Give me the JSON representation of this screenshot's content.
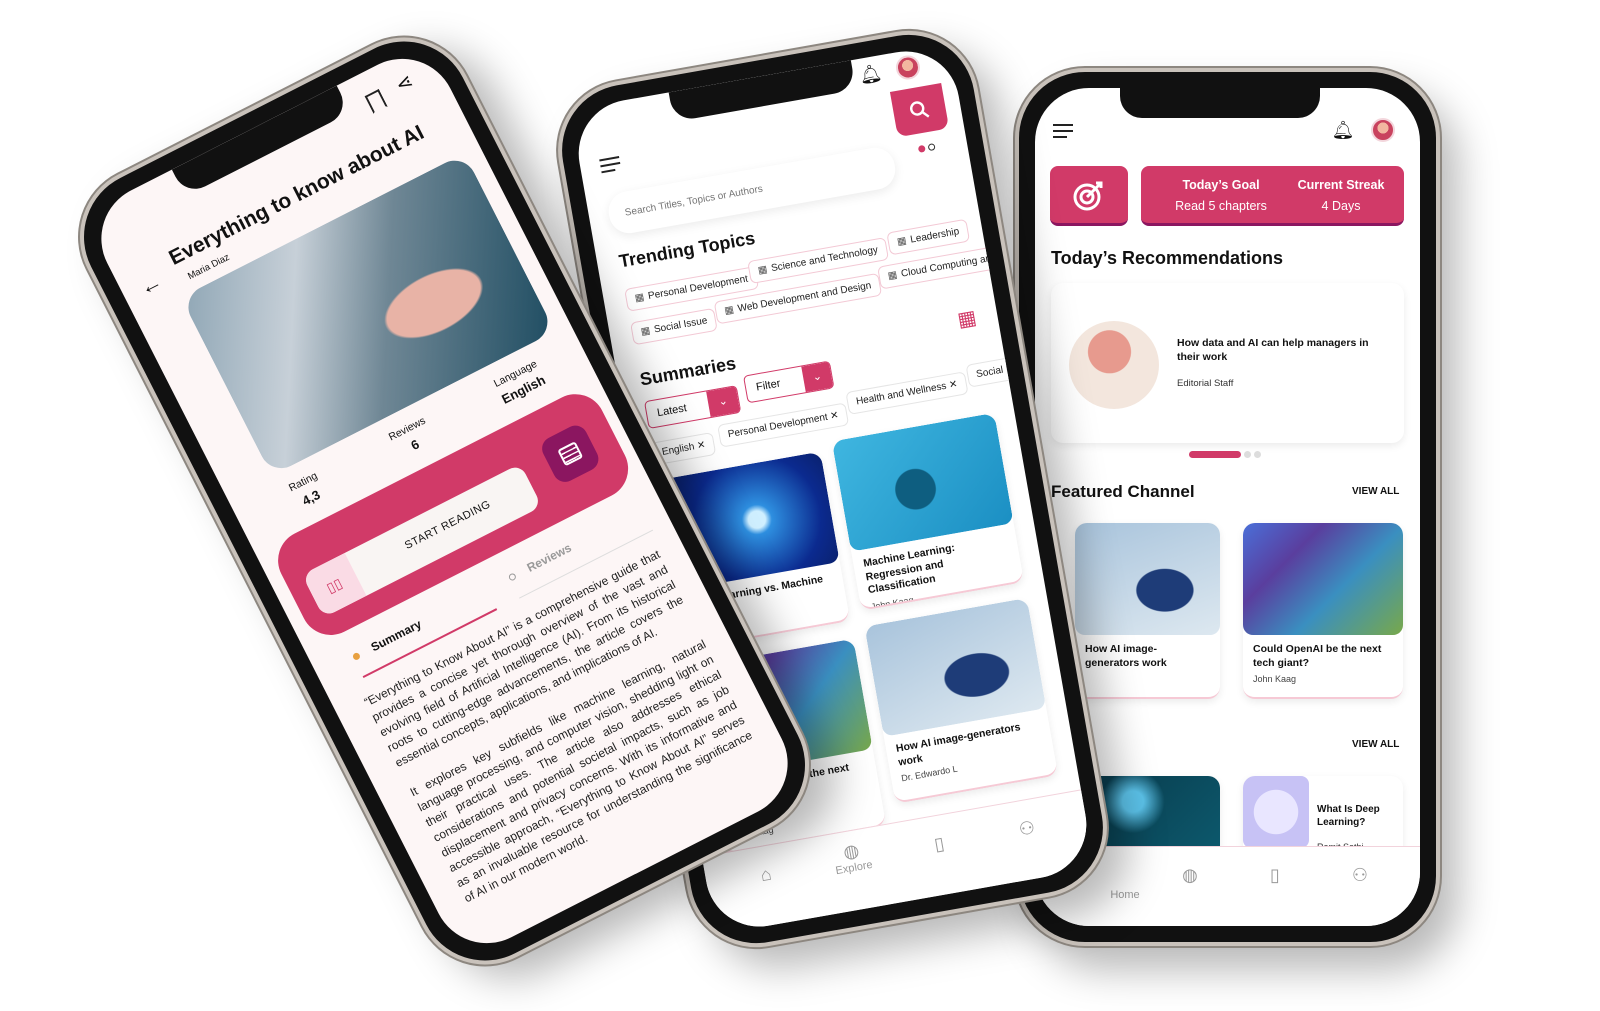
{
  "colors": {
    "accent": "#d13a68",
    "accent_dark": "#8b1660",
    "screen_bg": "#fdf6f6"
  },
  "home": {
    "goal": {
      "icon": "target-icon",
      "title": "Today’s Goal",
      "value": "Read 5 chapters"
    },
    "streak": {
      "title": "Current Streak",
      "value": "4 Days"
    },
    "recommendations_title": "Today’s Recommendations",
    "recommendation": {
      "title": "How data and AI can help managers in their work",
      "author": "Editorial Staff"
    },
    "featured_title": "Featured Channel",
    "view_all": "VIEW ALL",
    "featured_cards": [
      {
        "title": "How AI image-generators work"
      },
      {
        "title": "Could OpenAI be the next tech giant?",
        "author": "John Kaag"
      }
    ],
    "second_cards": [
      {
        "title": "What Is Deep Learning?",
        "author": "Ramit Sethi"
      }
    ],
    "nav": [
      {
        "label": "Home",
        "icon": "home-icon",
        "active": true
      },
      {
        "icon": "explore-icon"
      },
      {
        "icon": "bookmark-icon"
      },
      {
        "icon": "profile-icon"
      }
    ]
  },
  "explore": {
    "search_placeholder": "Search Titles, Topics or Authors",
    "trending_title": "Trending Topics",
    "topics": [
      "Personal Development",
      "Science and Technology",
      "Leadership",
      "Social Issue",
      "Web Development and Design",
      "Cloud Computing and"
    ],
    "summaries_title": "Summaries",
    "sort_label": "Latest",
    "filter_label": "Filter",
    "tags": [
      "English",
      "Personal Development",
      "Health and Wellness",
      "Social Is"
    ],
    "cards": [
      {
        "title": "Deep Learning vs. Machine Learning"
      },
      {
        "title": "Machine Learning: Regression and Classification",
        "author": "John Kaag"
      },
      {
        "title": "Could OpenAI be the next tech giant?",
        "author": "John Kaag"
      },
      {
        "title": "How AI image-generators work",
        "author": "Dr. Edwardo L"
      }
    ],
    "nav": [
      {
        "icon": "home-icon"
      },
      {
        "label": "Explore",
        "icon": "explore-icon",
        "active": true
      },
      {
        "icon": "bookmark-icon"
      },
      {
        "icon": "profile-icon"
      }
    ]
  },
  "detail": {
    "title": "Everything to know about AI",
    "author": "Maria Diaz",
    "stats": [
      {
        "label": "Rating",
        "value": "4,3"
      },
      {
        "label": "Reviews",
        "value": "6"
      },
      {
        "label": "Language",
        "value": "English"
      }
    ],
    "start_reading": "START READING",
    "tabs": [
      "Summary",
      "Reviews"
    ],
    "summary": [
      "“Everything to Know About AI” is a comprehensive guide that provides a concise yet thorough overview of the vast and evolving field of Artificial Intelligence (AI). From its historical roots to cutting-edge advancements, the article covers the essential concepts, applications, and implications of AI.",
      "It explores key subfields like machine learning, natural language processing, and computer vision, shedding light on their practical uses. The article also addresses ethical considerations and potential societal impacts, such as job displacement and privacy concerns. With its informative and accessible approach, “Everything to Know About AI” serves as an invaluable resource for understanding the significance of AI in our modern world."
    ]
  }
}
